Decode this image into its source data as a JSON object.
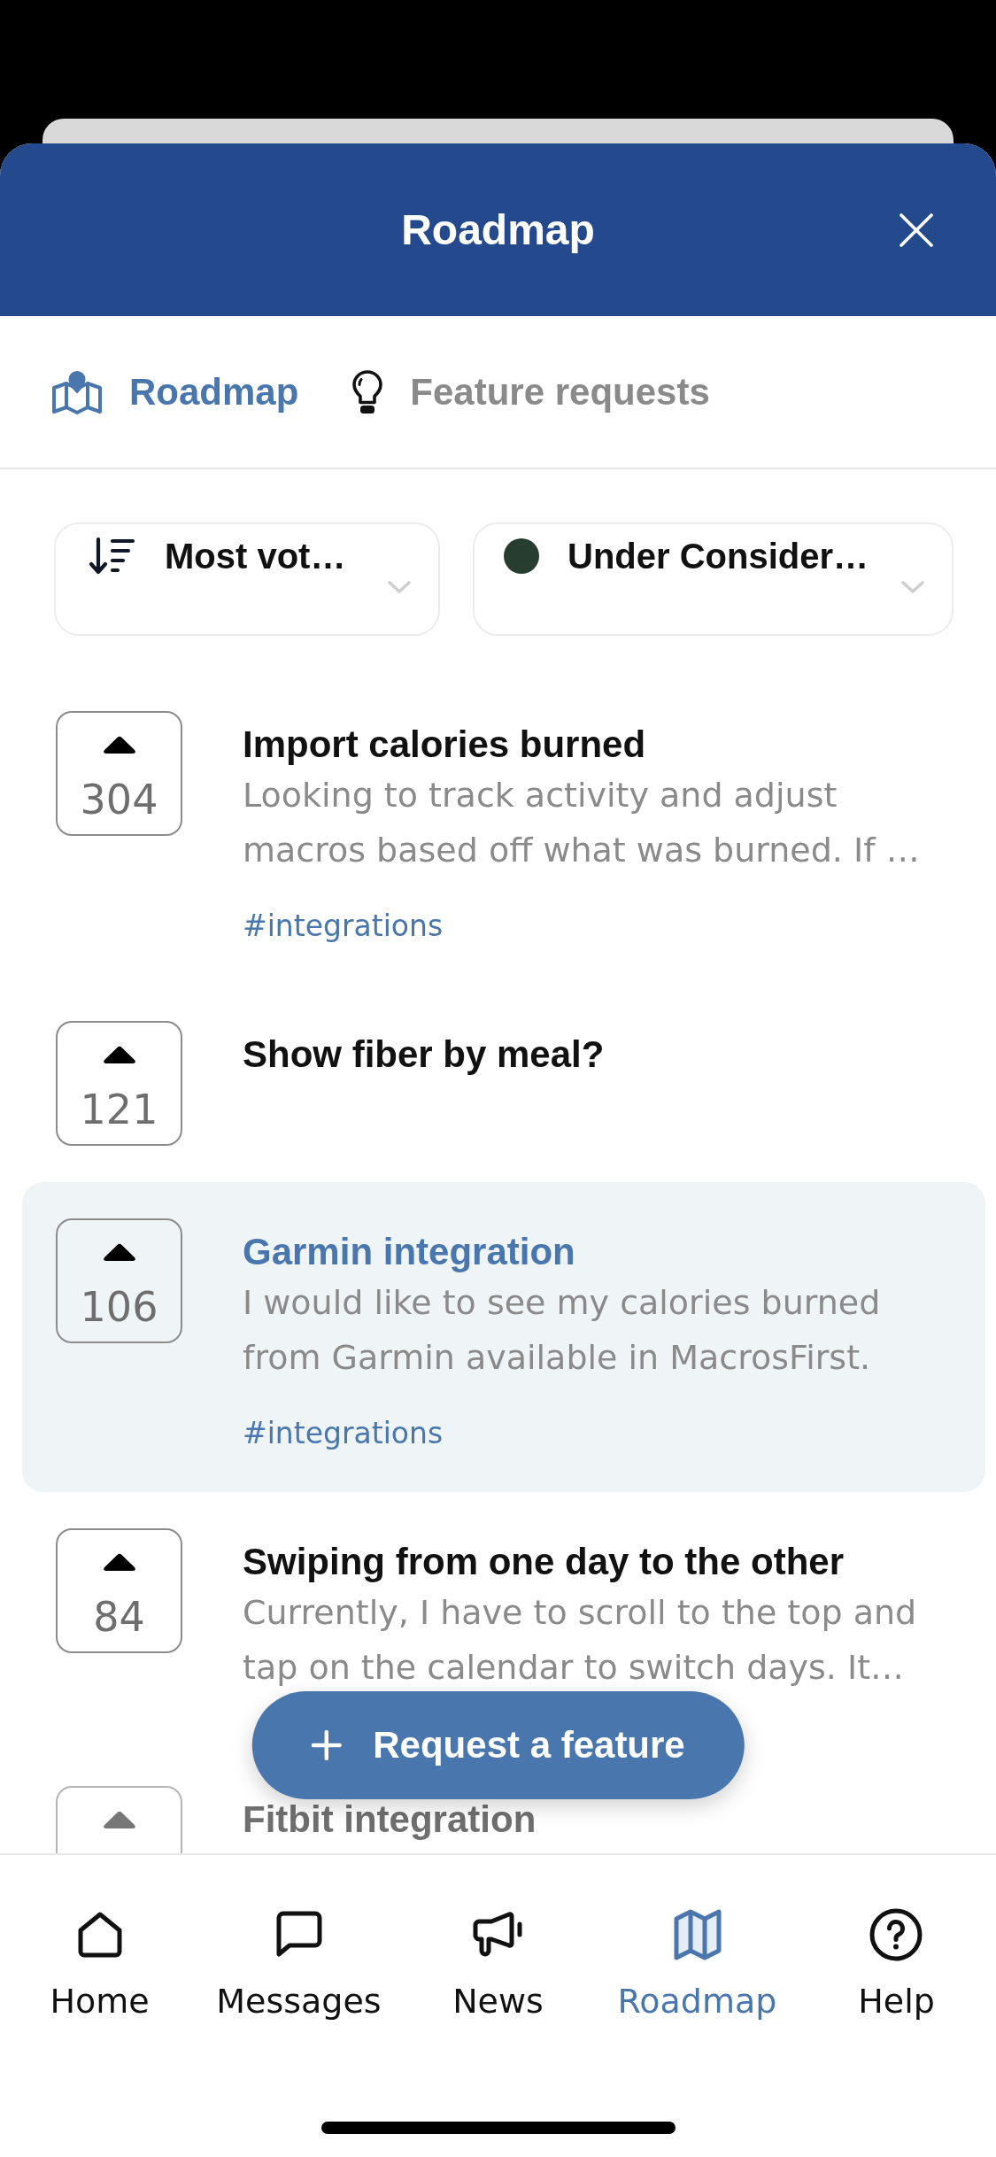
{
  "header": {
    "title": "Roadmap"
  },
  "tabs": [
    {
      "label": "Roadmap",
      "selected": true
    },
    {
      "label": "Feature requests",
      "selected": false
    }
  ],
  "filters": [
    {
      "kind": "sort",
      "value": "Most vot…"
    },
    {
      "kind": "status",
      "value": "Under Consider…",
      "color": "#263d30"
    }
  ],
  "requests": [
    {
      "votes": "304",
      "title": "Import calories burned",
      "description": "Looking to track activity and adjust macros based off what was burned. If …",
      "tag": "#integrations",
      "selected": false
    },
    {
      "votes": "121",
      "title": "Show fiber by meal?",
      "selected": false
    },
    {
      "votes": "106",
      "title": "Garmin integration",
      "description": "I would like to see my calories burned from Garmin available in MacrosFirst.",
      "tag": "#integrations",
      "selected": true
    },
    {
      "votes": "84",
      "title": "Swiping from one day to the other",
      "description": "Currently, I have to scroll to the top and tap on the calendar to switch days. It…",
      "selected": false
    },
    {
      "title": "Fitbit integration",
      "selected": false
    }
  ],
  "fab": {
    "label": "Request a feature"
  },
  "nav": [
    {
      "label": "Home",
      "selected": false
    },
    {
      "label": "Messages",
      "selected": false
    },
    {
      "label": "News",
      "selected": false
    },
    {
      "label": "Roadmap",
      "selected": true
    },
    {
      "label": "Help",
      "selected": false
    }
  ]
}
